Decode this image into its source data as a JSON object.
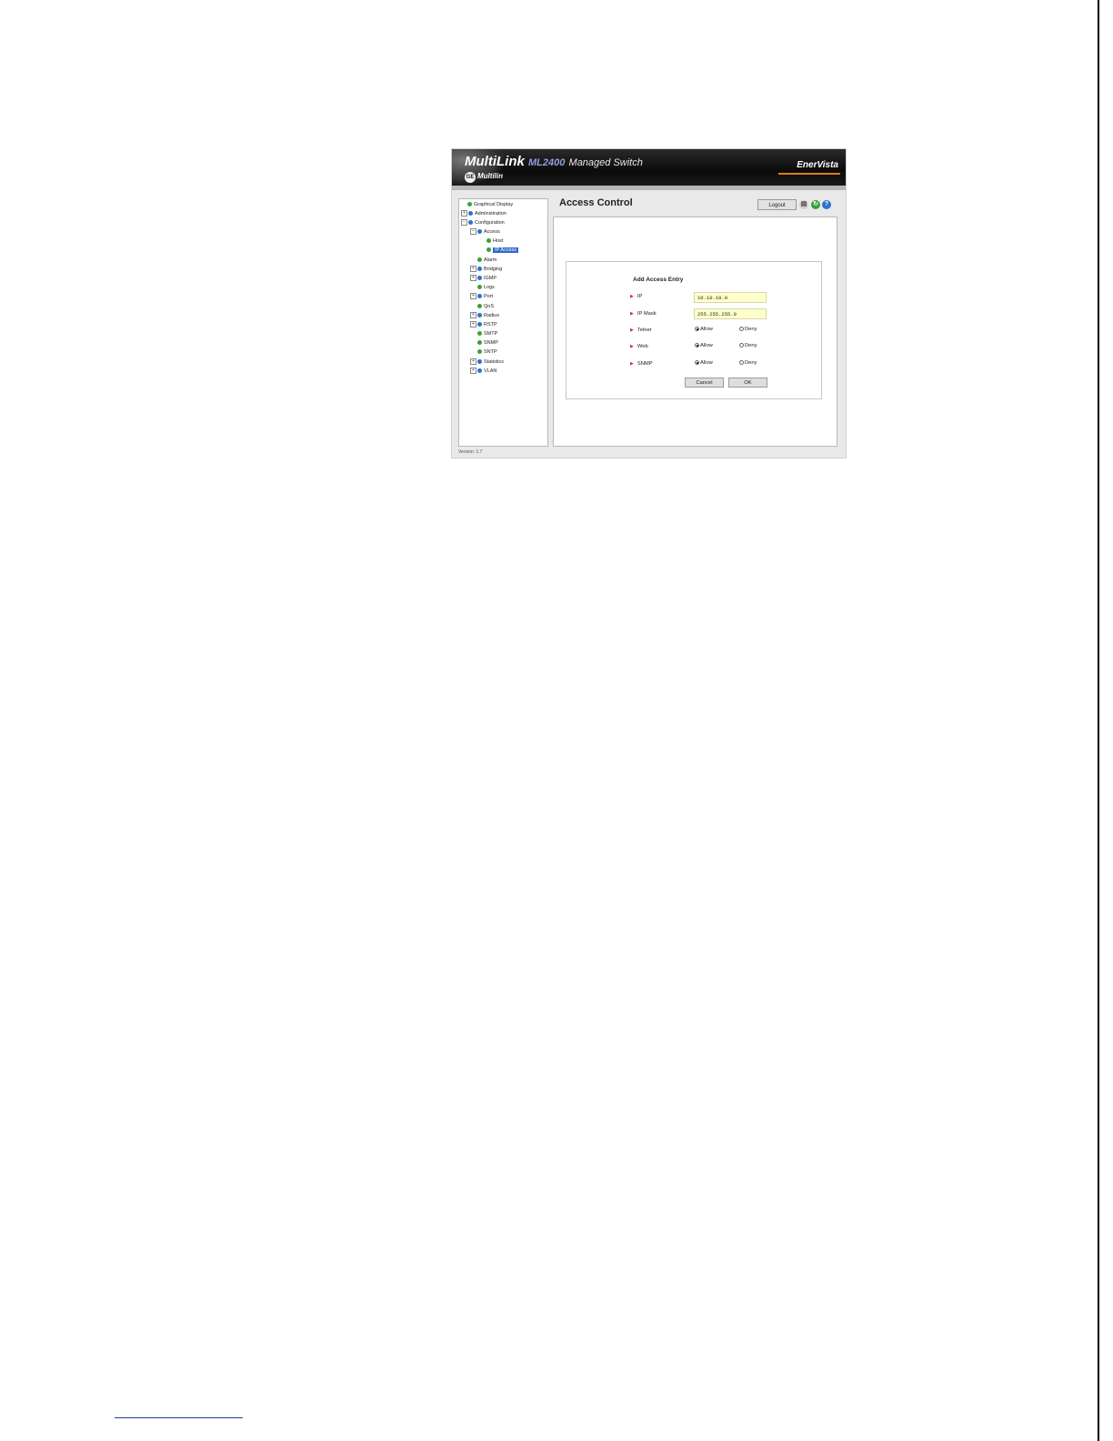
{
  "app": {
    "brand_name": "MultiLink",
    "model": "ML2400",
    "product": "Managed Switch",
    "company": "Multilin",
    "ge_mark": "GE",
    "enervista": "EnerVista"
  },
  "header": {
    "page_title": "Access Control",
    "logout_label": "Logout",
    "icons": [
      "print-icon",
      "refresh-icon",
      "help-icon"
    ]
  },
  "sidebar": {
    "items": [
      {
        "label": "Graphical Display"
      },
      {
        "label": "Administration"
      },
      {
        "label": "Configuration"
      },
      {
        "label": "Access"
      },
      {
        "label": "Host"
      },
      {
        "label": "IP Access"
      },
      {
        "label": "Alarm"
      },
      {
        "label": "Bridging"
      },
      {
        "label": "IGMP"
      },
      {
        "label": "Logs"
      },
      {
        "label": "Port"
      },
      {
        "label": "QoS"
      },
      {
        "label": "Radius"
      },
      {
        "label": "RSTP"
      },
      {
        "label": "SMTP"
      },
      {
        "label": "SNMP"
      },
      {
        "label": "SNTP"
      },
      {
        "label": "Statistics"
      },
      {
        "label": "VLAN"
      }
    ],
    "selected": "IP Access"
  },
  "version_text": "Version: 1.7",
  "form": {
    "title": "Add Access Entry",
    "ip_label": "IP",
    "ip_value": "10.10.10.0",
    "mask_label": "IP Mask",
    "mask_value": "255.255.255.0",
    "telnet_label": "Telnet",
    "web_label": "Web",
    "snmp_label": "SNMP",
    "allow_label": "Allow",
    "deny_label": "Deny",
    "telnet_selected": "Allow",
    "web_selected": "Allow",
    "snmp_selected": "Allow",
    "cancel_label": "Cancel",
    "ok_label": "OK"
  },
  "colors": {
    "banner": "#0b0b0b",
    "accent_orange": "#e07a18",
    "selection_blue": "#316ac5",
    "input_yellow": "#ffffcc"
  }
}
